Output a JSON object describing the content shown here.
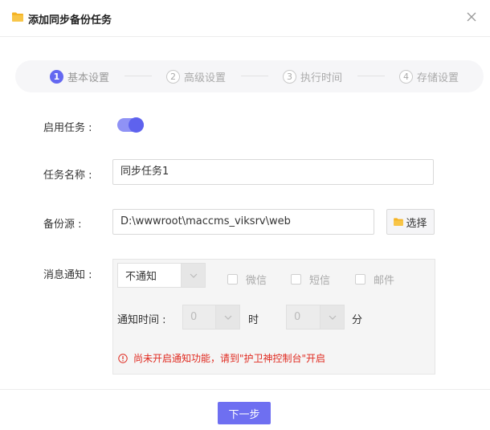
{
  "dialog": {
    "title": "添加同步备份任务"
  },
  "steps": [
    {
      "num": "1",
      "label": "基本设置"
    },
    {
      "num": "2",
      "label": "高级设置"
    },
    {
      "num": "3",
      "label": "执行时间"
    },
    {
      "num": "4",
      "label": "存储设置"
    }
  ],
  "form": {
    "enable_label": "启用任务 :",
    "enable_value": true,
    "name_label": "任务名称 :",
    "name_value": "同步任务1",
    "source_label": "备份源 :",
    "source_value": "D:\\wwwroot\\maccms_viksrv\\web",
    "select_button": "选择",
    "notify_label": "消息通知 :"
  },
  "notify": {
    "method_value": "不通知",
    "channels": [
      "微信",
      "短信",
      "邮件"
    ],
    "time_label": "通知时间 :",
    "hour_value": "0",
    "hour_unit": "时",
    "minute_value": "0",
    "minute_unit": "分",
    "warning": "尚未开启通知功能，请到\"护卫神控制台\"开启"
  },
  "footer": {
    "next_label": "下一步"
  },
  "colors": {
    "accent": "#6468f1",
    "warning": "#e0291f",
    "folder": "#f5b324"
  }
}
